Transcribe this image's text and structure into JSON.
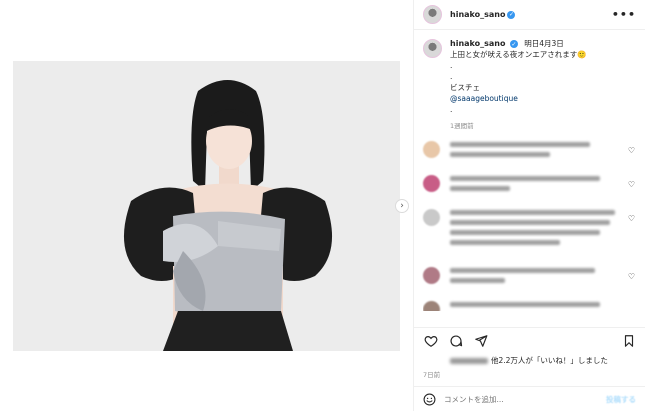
{
  "post": {
    "username": "hinako_sano",
    "caption_date": "明日4月3日",
    "caption_line1": "上田と女が吠える夜オンエアされます🙂",
    "caption_dot1": ".",
    "caption_dot2": ".",
    "caption_item": "ビスチェ",
    "caption_tag": "@saaageboutique",
    "caption_dot3": ".",
    "caption_ago": "1週間前"
  },
  "icons": {
    "verified": "verified-badge-icon",
    "more": "more-options-icon",
    "next": "chevron-right-icon",
    "like": "heart-icon",
    "comment": "comment-bubble-icon",
    "share": "paper-plane-icon",
    "save": "bookmark-icon",
    "emoji": "emoji-smile-icon"
  },
  "glyphs": {
    "more": "•••",
    "next": "›",
    "verified": "✓",
    "heart": "♡"
  },
  "comments": [
    {
      "avatar_color": "#e8c7a8"
    },
    {
      "avatar_color": "#c85d86"
    },
    {
      "avatar_color": "#c9c9c9"
    },
    {
      "avatar_color": "#b07a86"
    },
    {
      "avatar_color": "#9c8378"
    }
  ],
  "likes": {
    "prefix": "他2.2万人が「いいね！」しました"
  },
  "post_ago": "7日前",
  "composer": {
    "placeholder": "コメントを追加...",
    "post_label": "投稿する"
  },
  "colors": {
    "accent": "#3797f0",
    "link": "#00376b",
    "muted": "#8e8e8e"
  }
}
